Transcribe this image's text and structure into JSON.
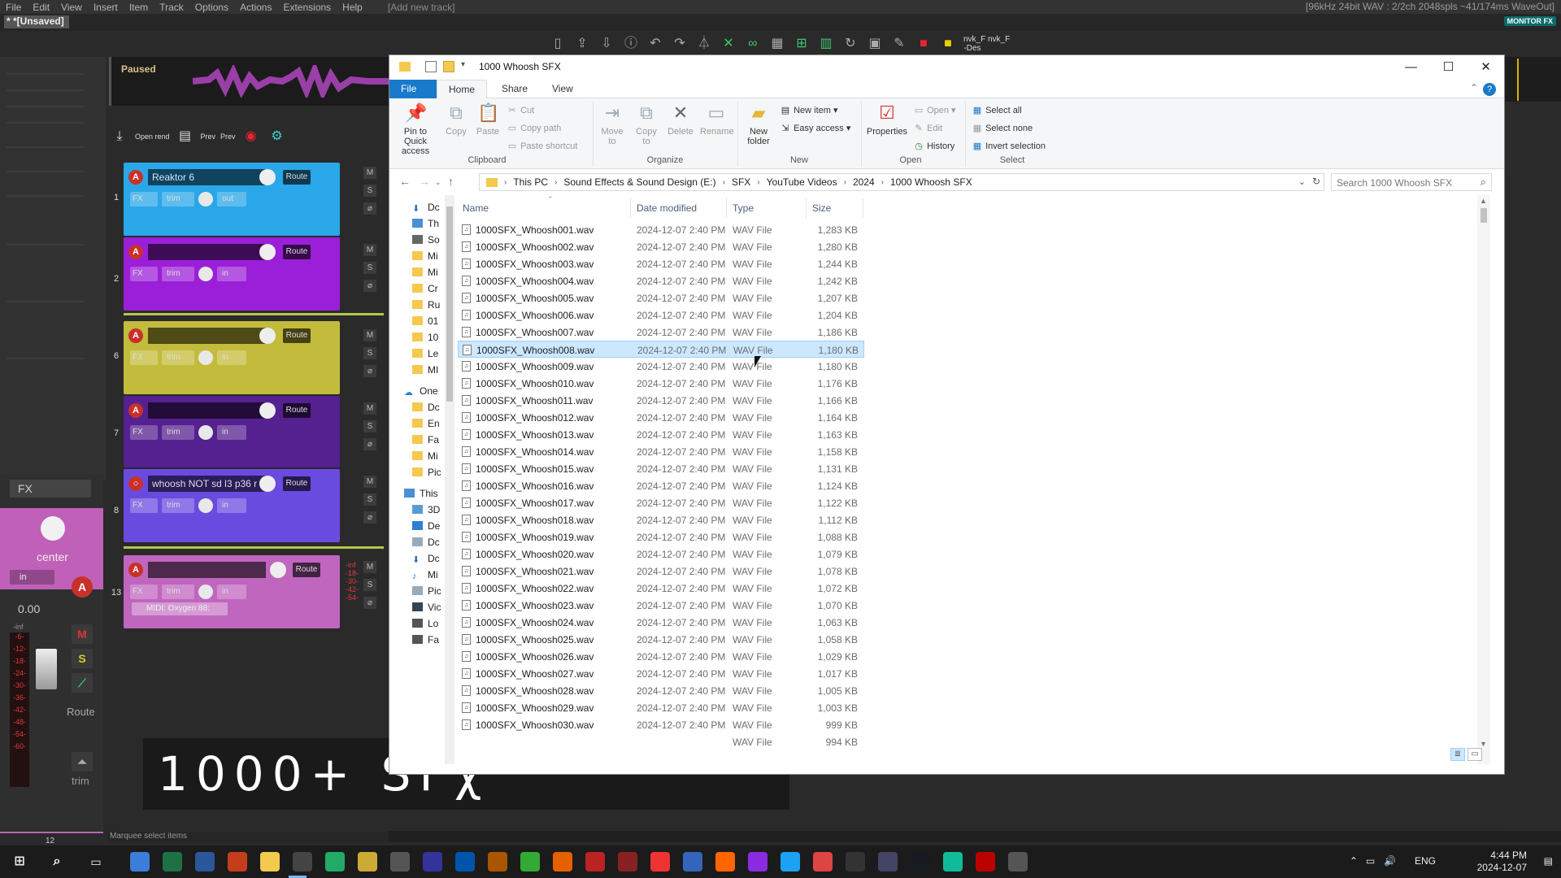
{
  "reaper": {
    "menu": [
      "File",
      "Edit",
      "View",
      "Insert",
      "Item",
      "Track",
      "Options",
      "Actions",
      "Extensions",
      "Help"
    ],
    "menu_hint": "[Add new track]",
    "status": "[96kHz 24bit WAV : 2/2ch 2048spls ~41/174ms WaveOut]",
    "project_tab": "* *[Unsaved]",
    "monitor_fx": "MONITOR FX",
    "transport_state": "Paused",
    "open_rend_label": "Open rend",
    "prev_label": "Prev",
    "prev2_label": "Prev",
    "toolbar_text": {
      "nvk1": "nvk_F -Des",
      "nvk2": "nvk_F"
    },
    "tracks": [
      {
        "num": "1",
        "name": "Reaktor 6",
        "route": "Route",
        "fx": "FX",
        "trim": "trim",
        "io": "out",
        "color": "#2aa7e8"
      },
      {
        "num": "2",
        "name": "",
        "route": "Route",
        "fx": "FX",
        "trim": "trim",
        "io": "in",
        "color": "#9b1fd8"
      },
      {
        "num": "6",
        "name": "",
        "route": "Route",
        "fx": "FX",
        "trim": "trim",
        "io": "in",
        "color": "#c3bb3b"
      },
      {
        "num": "7",
        "name": "",
        "route": "Route",
        "fx": "FX",
        "trim": "trim",
        "io": "in",
        "color": "#55208f"
      },
      {
        "num": "8",
        "name": "whoosh NOT sd l3 p36 r",
        "route": "Route",
        "fx": "FX",
        "trim": "trim",
        "io": "in",
        "color": "#6a4be0"
      },
      {
        "num": "13",
        "name": "",
        "route": "Route",
        "fx": "FX",
        "trim": "trim",
        "io": "in",
        "midi": "MIDI: Oxygen 88:",
        "color": "#c066bf"
      }
    ],
    "track13_meter": [
      "-inf",
      "-18-",
      "-30-",
      "-42-",
      "-54-"
    ],
    "mixer": {
      "fx": "FX",
      "pan": "center",
      "input": "in",
      "volume": "0.00",
      "inf": "-inf",
      "meter_ticks": [
        "-6-",
        "-12-",
        "-18-",
        "-24-",
        "-30-",
        "-36-",
        "-42-",
        "-48-",
        "-54-",
        "-60-"
      ],
      "mute": "M",
      "solo": "S",
      "route": "Route",
      "trim": "trim",
      "page": "12"
    },
    "marquee_hint": "Marquee select items",
    "caption": "1000+ SFχ"
  },
  "explorer": {
    "window_title": "1000 Whoosh SFX",
    "tabs": [
      "File",
      "Home",
      "Share",
      "View"
    ],
    "ribbon": {
      "clipboard": {
        "pin": "Pin to Quick access",
        "copy": "Copy",
        "paste": "Paste",
        "cut": "Cut",
        "copy_path": "Copy path",
        "paste_shortcut": "Paste shortcut",
        "label": "Clipboard"
      },
      "organize": {
        "move_to": "Move to",
        "copy_to": "Copy to",
        "delete": "Delete",
        "rename": "Rename",
        "label": "Organize"
      },
      "new": {
        "new_folder": "New folder",
        "new_item": "New item",
        "easy_access": "Easy access",
        "label": "New"
      },
      "open": {
        "properties": "Properties",
        "open": "Open",
        "edit": "Edit",
        "history": "History",
        "label": "Open"
      },
      "select": {
        "select_all": "Select all",
        "select_none": "Select none",
        "invert": "Invert selection",
        "label": "Select"
      }
    },
    "breadcrumb": [
      "This PC",
      "Sound Effects & Sound Design (E:)",
      "SFX",
      "YouTube Videos",
      "2024",
      "1000 Whoosh SFX"
    ],
    "search_placeholder": "Search 1000 Whoosh SFX",
    "nav_items": [
      "Dc",
      "Th",
      "So",
      "Mi",
      "Mi",
      "Cr",
      "Ru",
      "01",
      "10",
      "Le",
      "MI",
      "One",
      "Dc",
      "En",
      "Fa",
      "Mi",
      "Pic",
      "This",
      "3D",
      "De",
      "Dc",
      "Dc",
      "Mi",
      "Pic",
      "Vic",
      "Lo",
      "Fa"
    ],
    "columns": {
      "name": "Name",
      "date": "Date modified",
      "type": "Type",
      "size": "Size"
    },
    "selected_index": 7,
    "files": [
      {
        "name": "1000SFX_Whoosh001.wav",
        "date": "2024-12-07 2:40 PM",
        "type": "WAV File",
        "size": "1,283 KB"
      },
      {
        "name": "1000SFX_Whoosh002.wav",
        "date": "2024-12-07 2:40 PM",
        "type": "WAV File",
        "size": "1,280 KB"
      },
      {
        "name": "1000SFX_Whoosh003.wav",
        "date": "2024-12-07 2:40 PM",
        "type": "WAV File",
        "size": "1,244 KB"
      },
      {
        "name": "1000SFX_Whoosh004.wav",
        "date": "2024-12-07 2:40 PM",
        "type": "WAV File",
        "size": "1,242 KB"
      },
      {
        "name": "1000SFX_Whoosh005.wav",
        "date": "2024-12-07 2:40 PM",
        "type": "WAV File",
        "size": "1,207 KB"
      },
      {
        "name": "1000SFX_Whoosh006.wav",
        "date": "2024-12-07 2:40 PM",
        "type": "WAV File",
        "size": "1,204 KB"
      },
      {
        "name": "1000SFX_Whoosh007.wav",
        "date": "2024-12-07 2:40 PM",
        "type": "WAV File",
        "size": "1,186 KB"
      },
      {
        "name": "1000SFX_Whoosh008.wav",
        "date": "2024-12-07 2:40 PM",
        "type": "WAV File",
        "size": "1,180 KB"
      },
      {
        "name": "1000SFX_Whoosh009.wav",
        "date": "2024-12-07 2:40 PM",
        "type": "WAV File",
        "size": "1,180 KB"
      },
      {
        "name": "1000SFX_Whoosh010.wav",
        "date": "2024-12-07 2:40 PM",
        "type": "WAV File",
        "size": "1,176 KB"
      },
      {
        "name": "1000SFX_Whoosh011.wav",
        "date": "2024-12-07 2:40 PM",
        "type": "WAV File",
        "size": "1,166 KB"
      },
      {
        "name": "1000SFX_Whoosh012.wav",
        "date": "2024-12-07 2:40 PM",
        "type": "WAV File",
        "size": "1,164 KB"
      },
      {
        "name": "1000SFX_Whoosh013.wav",
        "date": "2024-12-07 2:40 PM",
        "type": "WAV File",
        "size": "1,163 KB"
      },
      {
        "name": "1000SFX_Whoosh014.wav",
        "date": "2024-12-07 2:40 PM",
        "type": "WAV File",
        "size": "1,158 KB"
      },
      {
        "name": "1000SFX_Whoosh015.wav",
        "date": "2024-12-07 2:40 PM",
        "type": "WAV File",
        "size": "1,131 KB"
      },
      {
        "name": "1000SFX_Whoosh016.wav",
        "date": "2024-12-07 2:40 PM",
        "type": "WAV File",
        "size": "1,124 KB"
      },
      {
        "name": "1000SFX_Whoosh017.wav",
        "date": "2024-12-07 2:40 PM",
        "type": "WAV File",
        "size": "1,122 KB"
      },
      {
        "name": "1000SFX_Whoosh018.wav",
        "date": "2024-12-07 2:40 PM",
        "type": "WAV File",
        "size": "1,112 KB"
      },
      {
        "name": "1000SFX_Whoosh019.wav",
        "date": "2024-12-07 2:40 PM",
        "type": "WAV File",
        "size": "1,088 KB"
      },
      {
        "name": "1000SFX_Whoosh020.wav",
        "date": "2024-12-07 2:40 PM",
        "type": "WAV File",
        "size": "1,079 KB"
      },
      {
        "name": "1000SFX_Whoosh021.wav",
        "date": "2024-12-07 2:40 PM",
        "type": "WAV File",
        "size": "1,078 KB"
      },
      {
        "name": "1000SFX_Whoosh022.wav",
        "date": "2024-12-07 2:40 PM",
        "type": "WAV File",
        "size": "1,072 KB"
      },
      {
        "name": "1000SFX_Whoosh023.wav",
        "date": "2024-12-07 2:40 PM",
        "type": "WAV File",
        "size": "1,070 KB"
      },
      {
        "name": "1000SFX_Whoosh024.wav",
        "date": "2024-12-07 2:40 PM",
        "type": "WAV File",
        "size": "1,063 KB"
      },
      {
        "name": "1000SFX_Whoosh025.wav",
        "date": "2024-12-07 2:40 PM",
        "type": "WAV File",
        "size": "1,058 KB"
      },
      {
        "name": "1000SFX_Whoosh026.wav",
        "date": "2024-12-07 2:40 PM",
        "type": "WAV File",
        "size": "1,029 KB"
      },
      {
        "name": "1000SFX_Whoosh027.wav",
        "date": "2024-12-07 2:40 PM",
        "type": "WAV File",
        "size": "1,017 KB"
      },
      {
        "name": "1000SFX_Whoosh028.wav",
        "date": "2024-12-07 2:40 PM",
        "type": "WAV File",
        "size": "1,005 KB"
      },
      {
        "name": "1000SFX_Whoosh029.wav",
        "date": "2024-12-07 2:40 PM",
        "type": "WAV File",
        "size": "1,003 KB"
      },
      {
        "name": "1000SFX_Whoosh030.wav",
        "date": "2024-12-07 2:40 PM",
        "type": "WAV File",
        "size": "999 KB"
      },
      {
        "name": "",
        "date": "",
        "type": "WAV File",
        "size": "994 KB"
      }
    ]
  },
  "taskbar": {
    "apps": [
      "copilot-icon",
      "excel-icon",
      "word-icon",
      "powerpoint-icon",
      "file-explorer-icon",
      "app-icon",
      "app-icon",
      "app-icon",
      "search-app-icon",
      "app-icon",
      "app-icon",
      "app-icon",
      "chrome-icon",
      "firefox-icon",
      "reaper-icon",
      "app-icon",
      "app-icon",
      "app-icon",
      "vlc-icon",
      "app-icon",
      "app-icon",
      "app-icon",
      "app-icon",
      "app-icon",
      "steam-icon",
      "app-icon",
      "filezilla-icon",
      "app-icon"
    ],
    "lang": "ENG",
    "time": "4:44 PM",
    "date": "2024-12-07"
  },
  "colors": {
    "explorer_accent": "#1979ca",
    "selection": "#cce8ff",
    "reaper_bg": "#2a2a2a"
  }
}
